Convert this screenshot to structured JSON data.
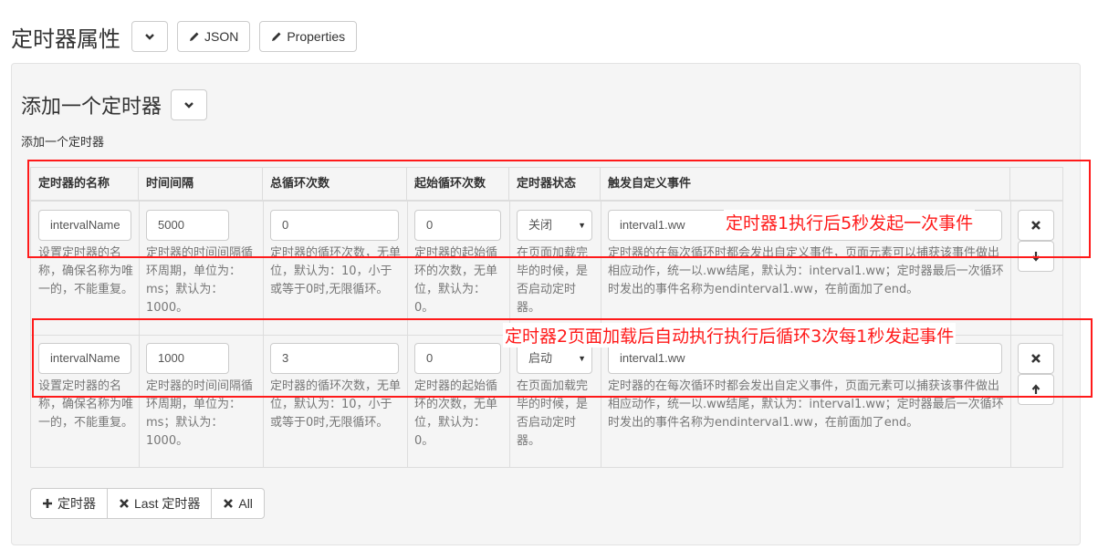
{
  "header": {
    "title": "定时器属性",
    "json_label": "JSON",
    "properties_label": "Properties"
  },
  "section": {
    "title": "添加一个定时器",
    "description": "添加一个定时器"
  },
  "table": {
    "columns": [
      "定时器的名称",
      "时间间隔",
      "总循环次数",
      "起始循环次数",
      "定时器状态",
      "触发自定义事件",
      ""
    ],
    "rows": [
      {
        "name": "intervalName",
        "interval": "5000",
        "total_loops": "0",
        "start_loop": "0",
        "status": "关闭",
        "event": "interval1.ww",
        "help": {
          "name": "设置定时器的名称，确保名称为唯一的，不能重复。",
          "interval": "定时器的时间间隔循环周期，单位为：ms；默认为：1000。",
          "total_loops": "定时器的循环次数，无单位，默认为：10，小于或等于0时,无限循环。",
          "start_loop": "定时器的起始循环的次数，无单位，默认为：0。",
          "status": "在页面加载完毕的时候，是否启动定时器。",
          "event": "定时器的在每次循环时都会发出自定义事件，页面元素可以捕获该事件做出相应动作，统一以.ww结尾，默认为：interval1.ww；定时器最后一次循环时发出的事件名称为endinterval1.ww，在前面加了end。"
        }
      },
      {
        "name": "intervalName",
        "interval": "1000",
        "total_loops": "3",
        "start_loop": "0",
        "status": "启动",
        "event": "interval1.ww",
        "help": {
          "name": "设置定时器的名称，确保名称为唯一的，不能重复。",
          "interval": "定时器的时间间隔循环周期，单位为：ms；默认为：1000。",
          "total_loops": "定时器的循环次数，无单位，默认为：10，小于或等于0时,无限循环。",
          "start_loop": "定时器的起始循环的次数，无单位，默认为：0。",
          "status": "在页面加载完毕的时候，是否启动定时器。",
          "event": "定时器的在每次循环时都会发出自定义事件，页面元素可以捕获该事件做出相应动作，统一以.ww结尾，默认为：interval1.ww；定时器最后一次循环时发出的事件名称为endinterval1.ww，在前面加了end。"
        }
      }
    ]
  },
  "annotations": [
    "定时器1执行后5秒发起一次事件",
    "定时器2页面加载后自动执行执行后循环3次每1秒发起事件"
  ],
  "footer": {
    "add_label": "定时器",
    "remove_last_label": "Last 定时器",
    "remove_all_label": "All"
  },
  "colors": {
    "annotation": "#ff1a1a",
    "border": "#dddddd",
    "panel_bg": "#f5f5f5"
  },
  "icons": [
    "chevron-down-icon",
    "pencil-icon",
    "close-icon",
    "arrow-down-icon",
    "arrow-up-icon",
    "plus-icon"
  ]
}
